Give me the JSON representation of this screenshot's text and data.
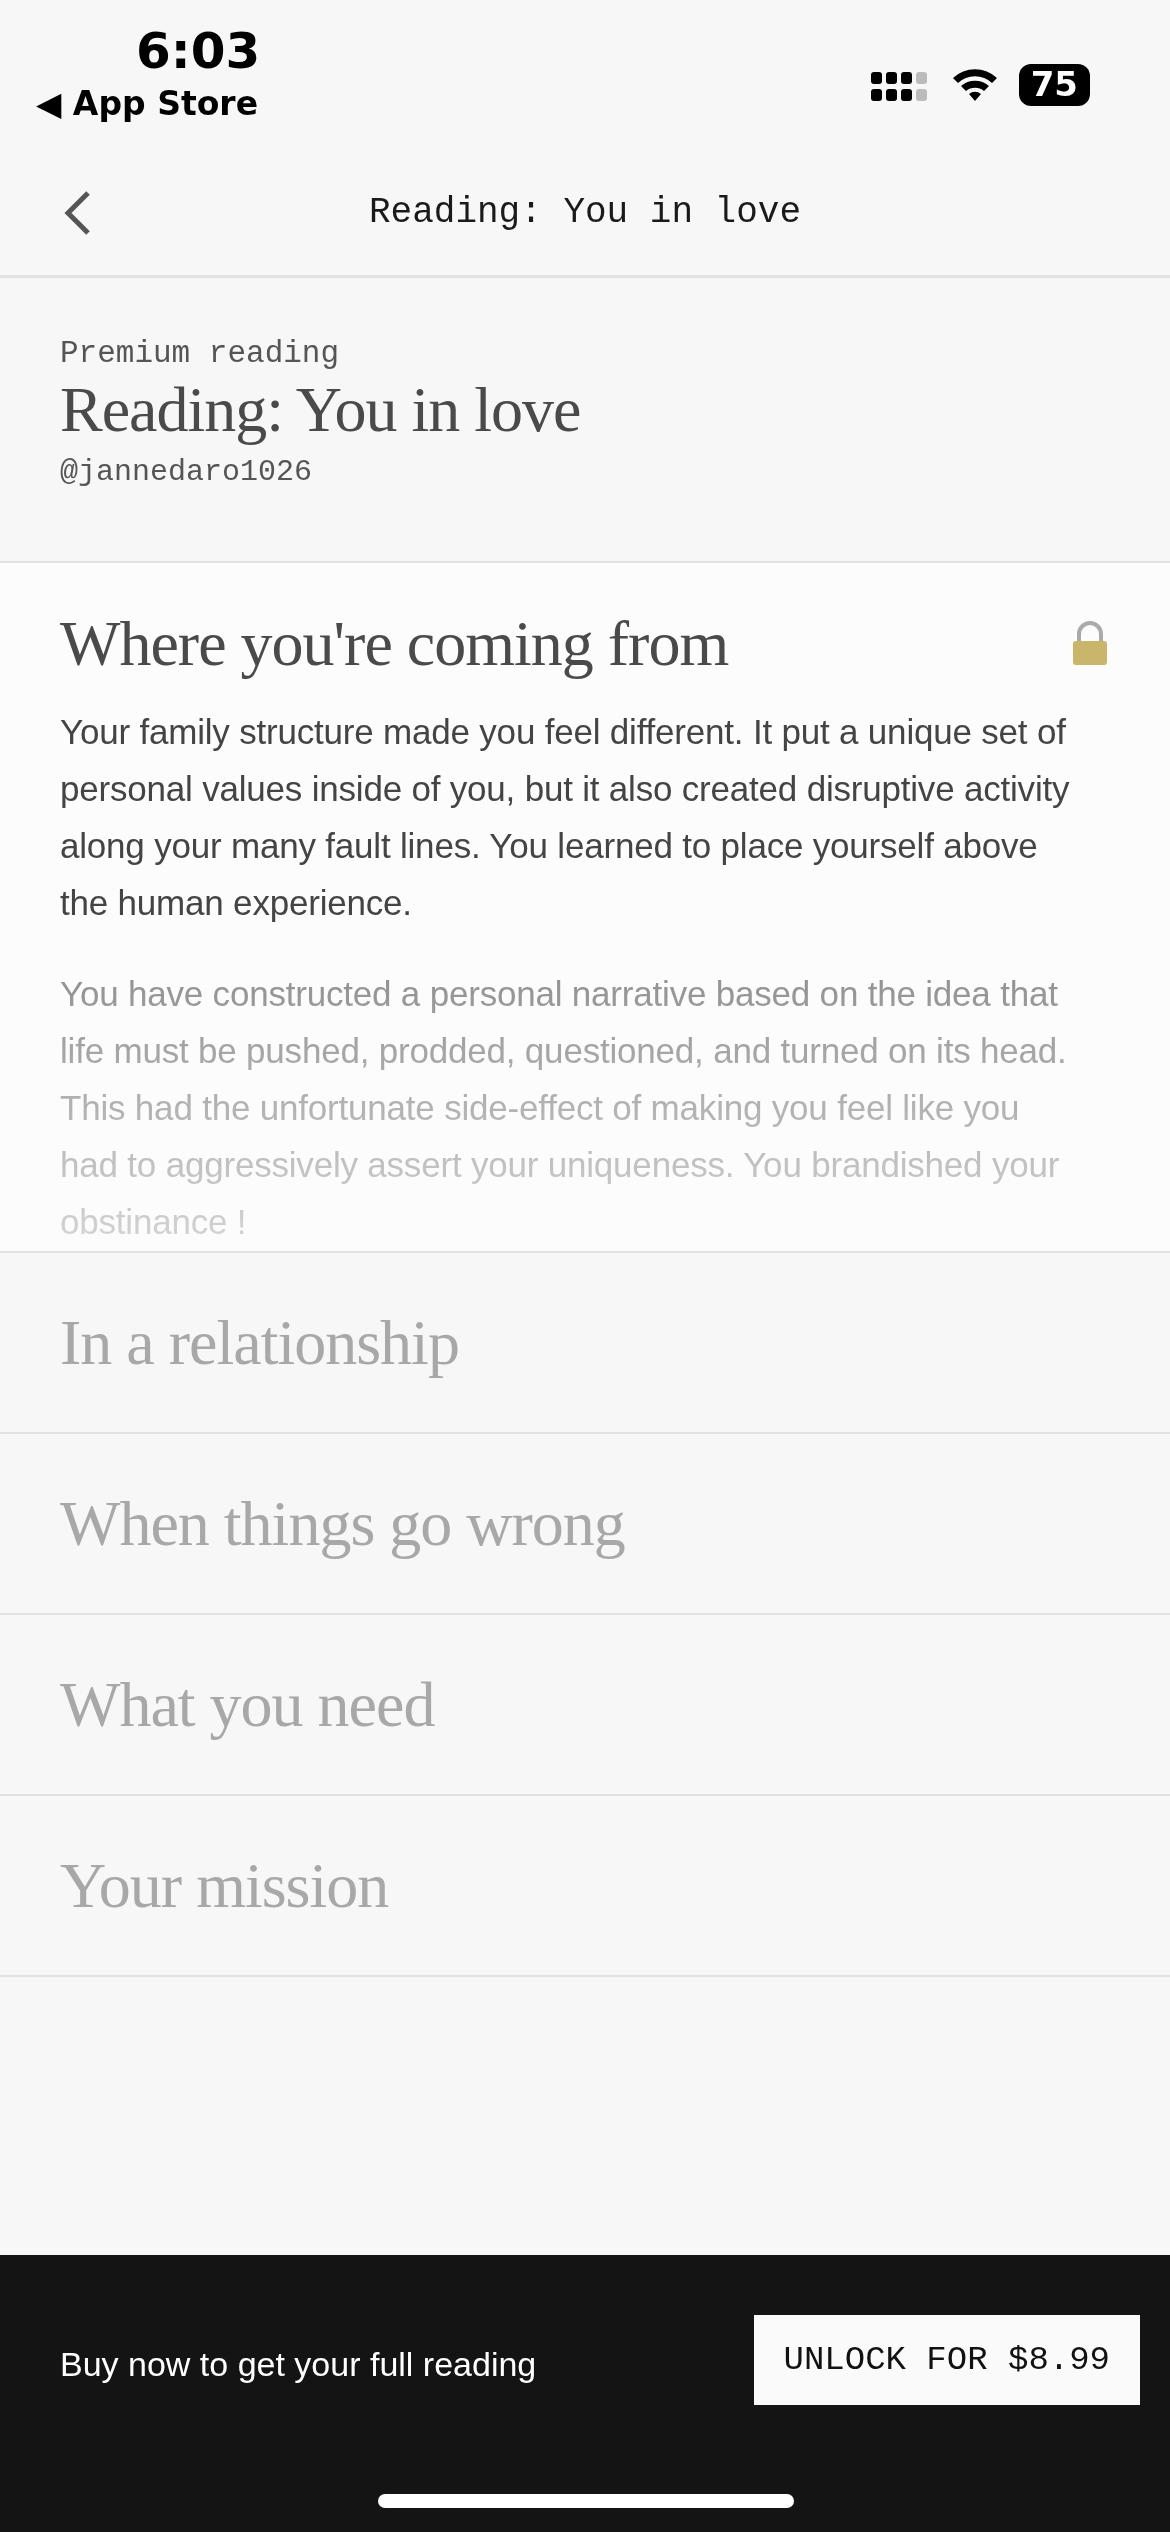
{
  "status_bar": {
    "time": "6:03",
    "back_label": "◀ App Store",
    "battery": "75"
  },
  "nav": {
    "title": "Reading: You in love"
  },
  "header": {
    "eyebrow": "Premium reading",
    "title": "Reading: You in love",
    "author": "@jannedaro1026"
  },
  "sections": [
    {
      "title": "Where you're coming from",
      "expanded": true,
      "locked": true,
      "paragraphs": [
        "Your family structure made you feel different. It put a unique set of personal values inside of you, but it also created disruptive activity along your many fault lines. You learned to place yourself above the human experience.",
        "You have constructed a personal narrative based on the idea that life must be pushed, prodded, questioned, and turned on its head. This had the unfortunate side-effect of making you feel like you had to aggressively assert your uniqueness. You brandished your obstinance !"
      ]
    },
    {
      "title": "In a relationship",
      "expanded": false,
      "locked": false
    },
    {
      "title": "When things go wrong",
      "expanded": false,
      "locked": false
    },
    {
      "title": "What you need",
      "expanded": false,
      "locked": false
    },
    {
      "title": "Your mission",
      "expanded": false,
      "locked": false
    }
  ],
  "purchase_bar": {
    "message": "Buy now to get your full reading",
    "button": "UNLOCK FOR $8.99"
  }
}
